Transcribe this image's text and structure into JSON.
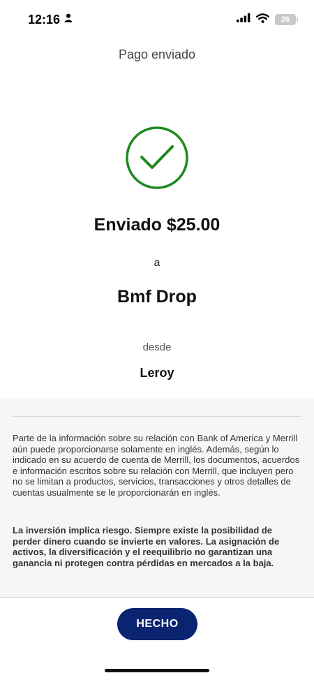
{
  "status_bar": {
    "time": "12:16",
    "battery_level": "26"
  },
  "header": {
    "title": "Pago enviado"
  },
  "confirmation": {
    "amount_text": "Enviado $25.00",
    "to_word": "a",
    "recipient": "Bmf Drop",
    "from_word": "desde",
    "sender": "Leroy",
    "success_color": "#1f8a1f"
  },
  "disclaimer": {
    "paragraph1": "Parte de la información sobre su relación con Bank of America y Merrill aún puede proporcionarse solamente en inglés. Además, según lo indicado en su acuerdo de cuenta de Merrill, los documentos, acuerdos e información escritos sobre su relación con Merrill, que incluyen pero no se limitan a productos, servicios, transacciones y otros detalles de cuentas usualmente se le proporcionarán en inglés.",
    "paragraph2": "La inversión implica riesgo. Siempre existe la posibilidad de perder dinero cuando se invierte en valores. La asignación de activos, la diversificación y el reequilibrio no garantizan una ganancia ni protegen contra pérdidas en mercados a la baja."
  },
  "footer": {
    "done_label": "HECHO",
    "button_color": "#0a2472"
  }
}
